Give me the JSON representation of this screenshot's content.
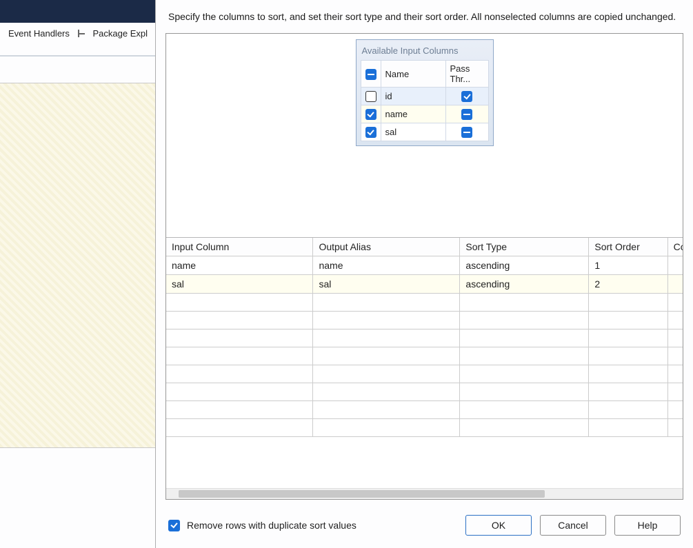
{
  "bg": {
    "tab_event_handlers": "Event Handlers",
    "tab_package_explorer": "Package Expl"
  },
  "dialog": {
    "instruction": "Specify the columns to sort, and set their sort type and their sort order. All nonselected columns are copied unchanged.",
    "available_title": "Available Input Columns",
    "available_headers": {
      "name": "Name",
      "pass": "Pass Thr..."
    },
    "available_rows": [
      {
        "name": "id"
      },
      {
        "name": "name"
      },
      {
        "name": "sal"
      }
    ],
    "sort_headers": {
      "input": "Input Column",
      "alias": "Output Alias",
      "type": "Sort Type",
      "order": "Sort Order",
      "comp": "Con"
    },
    "sort_rows": [
      {
        "input": "name",
        "alias": "name",
        "type": "ascending",
        "order": "1"
      },
      {
        "input": "sal",
        "alias": "sal",
        "type": "ascending",
        "order": "2"
      }
    ],
    "remove_dups_label": "Remove rows with duplicate sort values",
    "buttons": {
      "ok": "OK",
      "cancel": "Cancel",
      "help": "Help"
    }
  }
}
